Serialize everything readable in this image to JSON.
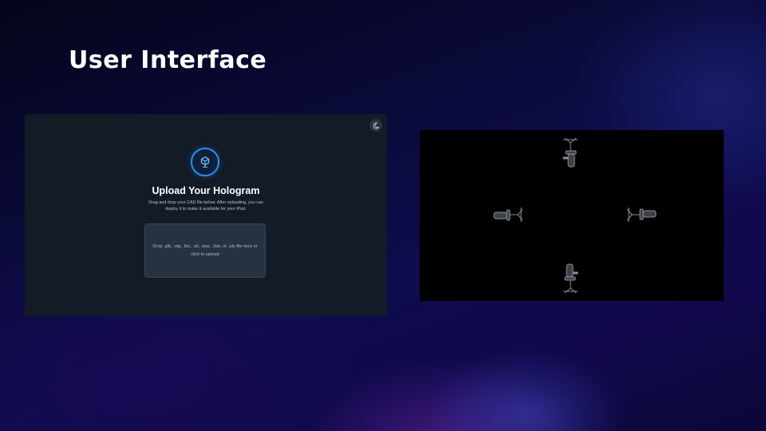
{
  "slide": {
    "title": "User Interface"
  },
  "upload_panel": {
    "theme_toggle_icon": "moon-icon",
    "logo_icon": "hologram-logo-icon",
    "heading": "Upload Your Hologram",
    "subtitle": "Drag and drop your CAD file below. After uploading, you can deploy it to make it available for your iPad.",
    "dropzone_text": "Drop .glb, .obj, .fbx, .stl, .dae, .3ds, or .ply file here or click to upload",
    "colors": {
      "panel_bg": "#121b26",
      "accent": "#2f8df0",
      "dropzone_bg": "#263241"
    }
  },
  "hologram_preview": {
    "background": "#000000",
    "views": [
      "top",
      "left",
      "right",
      "bottom"
    ],
    "object_icon": "office-chair-icon"
  }
}
